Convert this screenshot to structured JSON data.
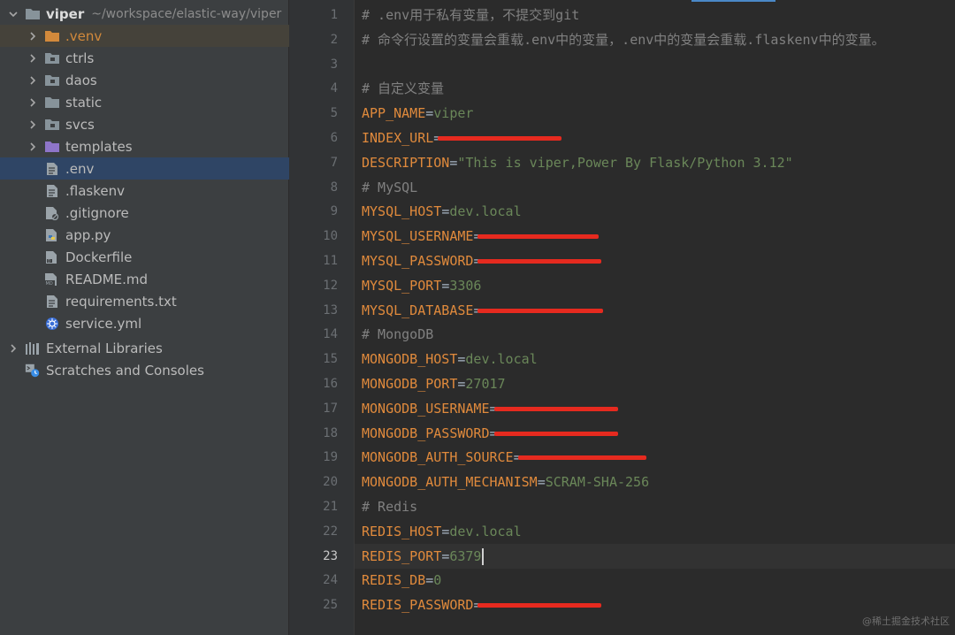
{
  "project": {
    "root_name": "viper",
    "root_path": "~/workspace/elastic-way/viper",
    "items": [
      {
        "label": ".venv"
      },
      {
        "label": "ctrls"
      },
      {
        "label": "daos"
      },
      {
        "label": "static"
      },
      {
        "label": "svcs"
      },
      {
        "label": "templates"
      },
      {
        "label": ".env"
      },
      {
        "label": ".flaskenv"
      },
      {
        "label": ".gitignore"
      },
      {
        "label": "app.py"
      },
      {
        "label": "Dockerfile"
      },
      {
        "label": "README.md"
      },
      {
        "label": "requirements.txt"
      },
      {
        "label": "service.yml"
      }
    ],
    "external_libraries": "External Libraries",
    "scratches": "Scratches and Consoles"
  },
  "editor": {
    "current_line": 23,
    "lines": [
      {
        "num": "1",
        "text": "# .env用于私有变量，不提交到git"
      },
      {
        "num": "2",
        "text": "# 命令行设置的变量会重载.env中的变量，.env中的变量会重载.flaskenv中的变量。"
      },
      {
        "num": "3",
        "text": ""
      },
      {
        "num": "4",
        "text": "# 自定义变量"
      },
      {
        "num": "5",
        "key": "APP_NAME",
        "value": "viper"
      },
      {
        "num": "6",
        "key": "INDEX_URL",
        "value": "",
        "redacted": true
      },
      {
        "num": "7",
        "key": "DESCRIPTION",
        "value": "\"This is viper,Power By Flask/Python 3.12\""
      },
      {
        "num": "8",
        "text": "# MySQL"
      },
      {
        "num": "9",
        "key": "MYSQL_HOST",
        "value": "dev.local"
      },
      {
        "num": "10",
        "key": "MYSQL_USERNAME",
        "value": "",
        "redacted": true
      },
      {
        "num": "11",
        "key": "MYSQL_PASSWORD",
        "value": "",
        "redacted": true
      },
      {
        "num": "12",
        "key": "MYSQL_PORT",
        "value": "3306"
      },
      {
        "num": "13",
        "key": "MYSQL_DATABASE",
        "value": "",
        "redacted": true
      },
      {
        "num": "14",
        "text": "# MongoDB"
      },
      {
        "num": "15",
        "key": "MONGODB_HOST",
        "value": "dev.local"
      },
      {
        "num": "16",
        "key": "MONGODB_PORT",
        "value": "27017"
      },
      {
        "num": "17",
        "key": "MONGODB_USERNAME",
        "value": "",
        "redacted": true
      },
      {
        "num": "18",
        "key": "MONGODB_PASSWORD",
        "value": "",
        "redacted": true
      },
      {
        "num": "19",
        "key": "MONGODB_AUTH_SOURCE",
        "value": "",
        "redacted": true
      },
      {
        "num": "20",
        "key": "MONGODB_AUTH_MECHANISM",
        "value": "SCRAM-SHA-256"
      },
      {
        "num": "21",
        "text": "# Redis"
      },
      {
        "num": "22",
        "key": "REDIS_HOST",
        "value": "dev.local"
      },
      {
        "num": "23",
        "key": "REDIS_PORT",
        "value": "6379"
      },
      {
        "num": "24",
        "key": "REDIS_DB",
        "value": "0"
      },
      {
        "num": "25",
        "key": "REDIS_PASSWORD",
        "value": "",
        "redacted": true
      }
    ],
    "equals": "="
  },
  "watermark": "@稀土掘金技术社区",
  "colors": {
    "key": "#e08a3c",
    "value": "#6a8759",
    "comment": "#808080",
    "redaction": "#e62a1f",
    "selection": "#2f4565"
  }
}
